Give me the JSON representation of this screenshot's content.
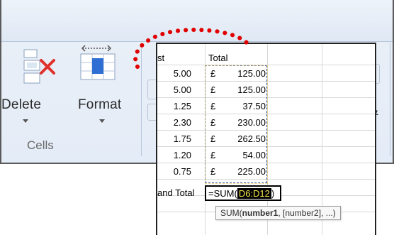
{
  "ribbon": {
    "delete": {
      "label": "Delete"
    },
    "format": {
      "label": "Format"
    },
    "group_label": "Cells",
    "partial_symbol": "&"
  },
  "sheet": {
    "header_left": "st",
    "header_total": "Total",
    "rows": [
      {
        "rate": "5.00",
        "pound": "£",
        "amount": "125.00"
      },
      {
        "rate": "5.00",
        "pound": "£",
        "amount": "125.00"
      },
      {
        "rate": "1.25",
        "pound": "£",
        "amount": "37.50"
      },
      {
        "rate": "2.30",
        "pound": "£",
        "amount": "230.00"
      },
      {
        "rate": "1.75",
        "pound": "£",
        "amount": "262.50"
      },
      {
        "rate": "1.20",
        "pound": "£",
        "amount": "54.00"
      },
      {
        "rate": "0.75",
        "pound": "£",
        "amount": "225.00"
      }
    ],
    "grand_total_label": "and Total",
    "formula_prefix": "=SUM(",
    "formula_range": "D6:D12",
    "formula_suffix": ")"
  },
  "tooltip": {
    "func": "SUM(",
    "bold_arg": "number1",
    "rest": ", [number2], ...)"
  },
  "colors": {
    "callout": "#e00000",
    "range_highlight_bg": "#000000",
    "range_highlight_text": "#f5e44a",
    "marching_ants": "#3a56b0"
  }
}
